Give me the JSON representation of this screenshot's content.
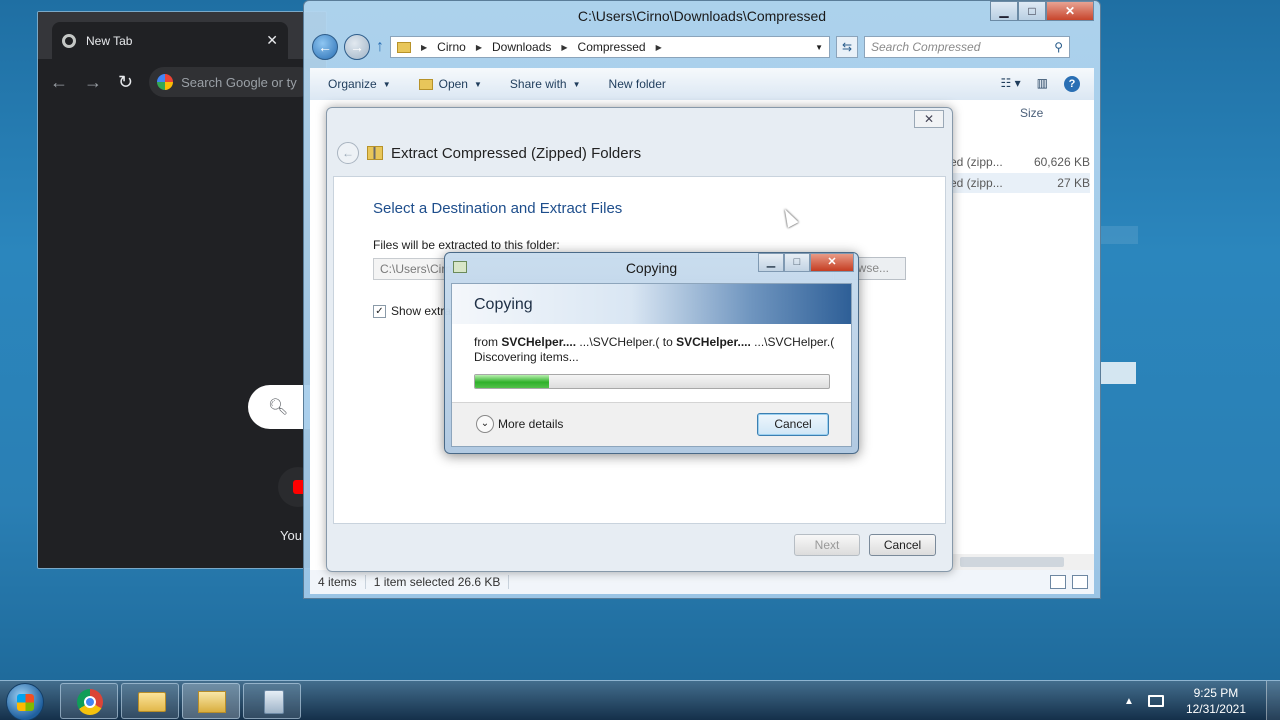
{
  "chrome": {
    "tab_title": "New Tab",
    "tab_close": "✕",
    "omnibox_placeholder": "Search Google or ty",
    "ntp_shortcut_label": "You"
  },
  "explorer": {
    "title": "C:\\Users\\Cirno\\Downloads\\Compressed",
    "path": [
      "Cirno",
      "Downloads",
      "Compressed"
    ],
    "search_placeholder": "Search Compressed",
    "toolbar": {
      "organize": "Organize",
      "open": "Open",
      "share_with": "Share with",
      "new_folder": "New folder"
    },
    "column_size": "Size",
    "rows": [
      {
        "type": "ed (zipp...",
        "size": "60,626 KB"
      },
      {
        "type": "ed (zipp...",
        "size": "27 KB"
      }
    ],
    "status": {
      "items": "4 items",
      "selected": "1 item selected  26.6 KB"
    }
  },
  "wizard": {
    "title": "Extract Compressed (Zipped) Folders",
    "subtitle": "Select a Destination and Extract Files",
    "folder_label": "Files will be extracted to this folder:",
    "path_value": "C:\\Users\\Cirno",
    "browse_label": "owse...",
    "show_label": "Show extra",
    "next_label": "Next",
    "cancel_label": "Cancel"
  },
  "copy_dialog": {
    "title": "Copying",
    "heading": "Copying",
    "from_word": "from",
    "from_name": "SVCHelper....",
    "from_path": "...\\SVCHelper.(",
    "to_word": "to",
    "to_name": "SVCHelper....",
    "to_path": "...\\SVCHelper.(",
    "status": "Discovering items...",
    "progress_fraction": 0.21,
    "more_details": "More details",
    "cancel_label": "Cancel"
  },
  "taskbar": {
    "time": "9:25 PM",
    "date": "12/31/2021"
  }
}
